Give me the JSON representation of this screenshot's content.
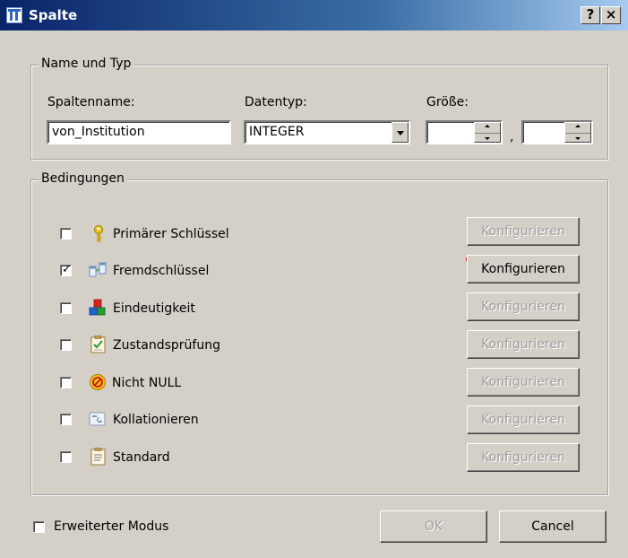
{
  "window": {
    "title": "Spalte",
    "help_label": "?",
    "close_label": "×"
  },
  "name_group": {
    "legend": "Name und Typ",
    "column_name_label": "Spaltenname:",
    "column_name_value": "von_Institution",
    "datatype_label": "Datentyp:",
    "datatype_value": "INTEGER",
    "size_label": "Größe:",
    "size_value": "",
    "separator": ",",
    "scale_value": ""
  },
  "constraints_group": {
    "legend": "Bedingungen",
    "configure_label": "Konfigurieren",
    "items": [
      {
        "label": "Primärer Schlüssel",
        "checked": false,
        "icon": "key-icon",
        "configure_enabled": false
      },
      {
        "label": "Fremdschlüssel",
        "checked": true,
        "icon": "foreign-key-icon",
        "configure_enabled": true,
        "warning": true
      },
      {
        "label": "Eindeutigkeit",
        "checked": false,
        "icon": "unique-icon",
        "configure_enabled": false
      },
      {
        "label": "Zustandsprüfung",
        "checked": false,
        "icon": "check-constraint-icon",
        "configure_enabled": false
      },
      {
        "label": "Nicht NULL",
        "checked": false,
        "icon": "not-null-icon",
        "configure_enabled": false
      },
      {
        "label": "Kollationieren",
        "checked": false,
        "icon": "collate-icon",
        "configure_enabled": false
      },
      {
        "label": "Standard",
        "checked": false,
        "icon": "default-value-icon",
        "configure_enabled": false
      }
    ]
  },
  "footer": {
    "advanced_mode_label": "Erweiterter Modus",
    "advanced_mode_checked": false,
    "ok_label": "OK",
    "cancel_label": "Cancel"
  },
  "colors": {
    "title_gradient_start": "#0a246a",
    "title_gradient_end": "#a6caf0",
    "dialog_background": "#d4d0c8",
    "warning": "#d21010"
  }
}
